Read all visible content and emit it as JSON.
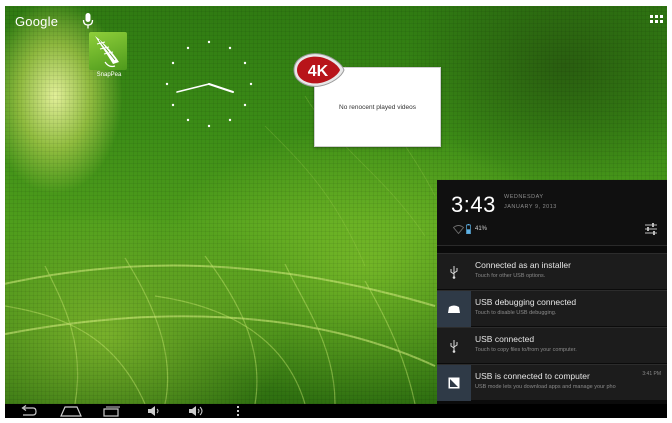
{
  "search": {
    "label": "Google"
  },
  "desktop": {
    "shortcut": {
      "label": "SnapPea"
    },
    "video_widget": {
      "badge": "4K",
      "empty_text": "No renocent played videos"
    }
  },
  "notifications": {
    "time": "3:43",
    "weekday": "WEDNESDAY",
    "date": "JANUARY 9, 2013",
    "battery": "41%",
    "items": [
      {
        "title": "Connected as an installer",
        "subtitle": "Touch for other USB options.",
        "time": "",
        "icon": "usb-icon"
      },
      {
        "title": "USB debugging connected",
        "subtitle": "Touch to disable USB debugging.",
        "time": "",
        "icon": "android-debug-icon"
      },
      {
        "title": "USB connected",
        "subtitle": "Touch to copy files to/from your computer.",
        "time": "",
        "icon": "usb-icon"
      },
      {
        "title": "USB is connected to computer",
        "subtitle": "USB mode lets you download apps and manage your pho",
        "time": "3:41 PM",
        "icon": "usb-mode-icon"
      }
    ]
  },
  "navbar": {
    "buttons": [
      "back-icon",
      "home-icon",
      "recent-apps-icon",
      "volume-down-icon",
      "volume-up-icon",
      "menu-icon"
    ]
  },
  "colors": {
    "wallpaper_green": "#3b8c16",
    "panel_bg": "#0b0b0b",
    "notif_icon_highlight": "#2f3a47",
    "badge_red": "#b8141a"
  }
}
